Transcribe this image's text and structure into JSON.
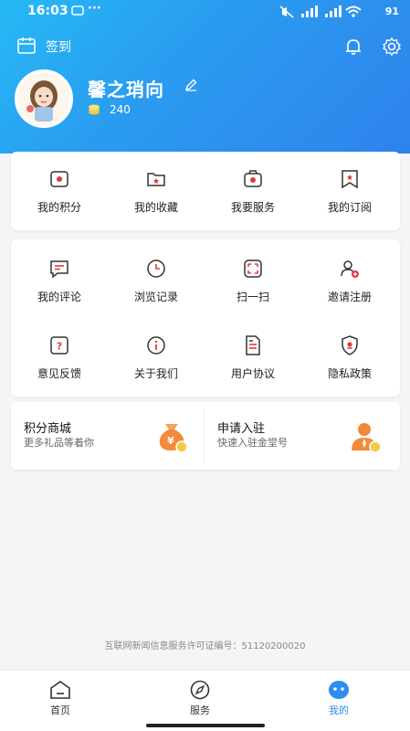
{
  "status_bar": {
    "time": "16:03",
    "battery": "91"
  },
  "header": {
    "sign_in_label": "签到",
    "username": "馨之琑向",
    "points": "240"
  },
  "colors": {
    "accent": "#2e8df0",
    "icon_red": "#e03a3a",
    "header_start": "#26b9f5",
    "header_end": "#2f82ec"
  },
  "quick_menu": [
    {
      "label": "我的积分",
      "icon": "points-icon"
    },
    {
      "label": "我的收藏",
      "icon": "favorites-icon"
    },
    {
      "label": "我要服务",
      "icon": "service-icon"
    },
    {
      "label": "我的订阅",
      "icon": "subscription-icon"
    }
  ],
  "tools_menu": [
    {
      "label": "我的评论",
      "icon": "comment-icon"
    },
    {
      "label": "浏览记录",
      "icon": "history-icon"
    },
    {
      "label": "扫一扫",
      "icon": "scan-icon"
    },
    {
      "label": "邀请注册",
      "icon": "invite-icon"
    },
    {
      "label": "意见反馈",
      "icon": "feedback-icon"
    },
    {
      "label": "关于我们",
      "icon": "about-icon"
    },
    {
      "label": "用户协议",
      "icon": "agreement-icon"
    },
    {
      "label": "隐私政策",
      "icon": "privacy-icon"
    }
  ],
  "promos": [
    {
      "title": "积分商城",
      "subtitle": "更多礼品等着你",
      "icon": "money-bag-icon"
    },
    {
      "title": "申请入驻",
      "subtitle": "快速入驻金堂号",
      "icon": "person-badge-icon"
    }
  ],
  "license_text": "互联网新闻信息服务许可证编号：51120200020",
  "bottom_nav": [
    {
      "label": "首页",
      "icon": "home-icon",
      "active": false
    },
    {
      "label": "服务",
      "icon": "compass-icon",
      "active": false
    },
    {
      "label": "我的",
      "icon": "profile-icon",
      "active": true
    }
  ]
}
